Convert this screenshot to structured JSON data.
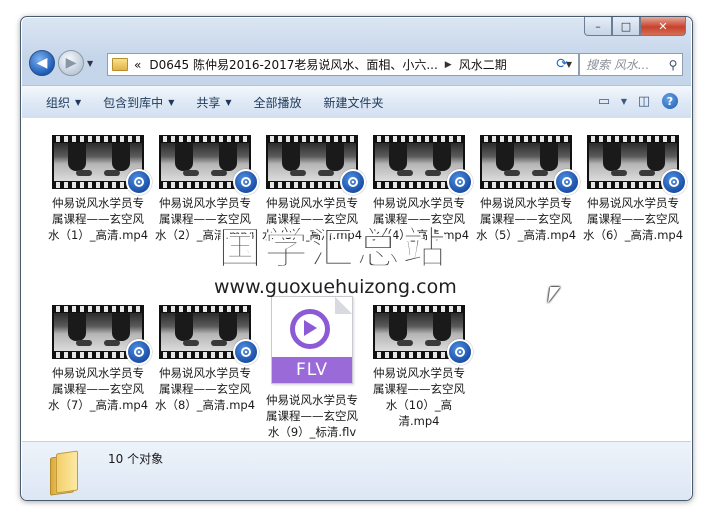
{
  "window": {
    "caption_buttons": {
      "minimize": "–",
      "maximize": "□",
      "close": "✕"
    }
  },
  "nav": {
    "back_icon": "◀",
    "forward_icon": "▶"
  },
  "address_bar": {
    "prefix": "«",
    "segments": [
      "D0645 陈仲易2016-2017老易说风水、面相、小六...",
      "风水二期"
    ],
    "separator": "▶"
  },
  "search": {
    "placeholder": "搜索 风水...",
    "icon": "search-icon"
  },
  "toolbar": {
    "organize": "组织",
    "include_in_library": "包含到库中",
    "share": "共享",
    "play_all": "全部播放",
    "new_folder": "新建文件夹"
  },
  "files": [
    {
      "name": "仲易说风水学员专属课程——玄空风水（1）_高清.mp4",
      "type": "mp4"
    },
    {
      "name": "仲易说风水学员专属课程——玄空风水（2）_高清.mp4",
      "type": "mp4"
    },
    {
      "name": "仲易说风水学员专属课程——玄空风水（3）_高清.mp4",
      "type": "mp4"
    },
    {
      "name": "仲易说风水学员专属课程——玄空风水（4）_高清.mp4",
      "type": "mp4"
    },
    {
      "name": "仲易说风水学员专属课程——玄空风水（5）_高清.mp4",
      "type": "mp4"
    },
    {
      "name": "仲易说风水学员专属课程——玄空风水（6）_高清.mp4",
      "type": "mp4"
    },
    {
      "name": "仲易说风水学员专属课程——玄空风水（7）_高清.mp4",
      "type": "mp4"
    },
    {
      "name": "仲易说风水学员专属课程——玄空风水（8）_高清.mp4",
      "type": "mp4"
    },
    {
      "name": "仲易说风水学员专属课程——玄空风水（9）_标清.flv",
      "type": "flv",
      "badge": "FLV"
    },
    {
      "name": "仲易说风水学员专属课程——玄空风水（10）_高清.mp4",
      "type": "mp4"
    }
  ],
  "status": {
    "count": "10 个对象"
  },
  "watermark": {
    "title": "国学汇总站",
    "url": "www.guoxuehuizong.com"
  }
}
